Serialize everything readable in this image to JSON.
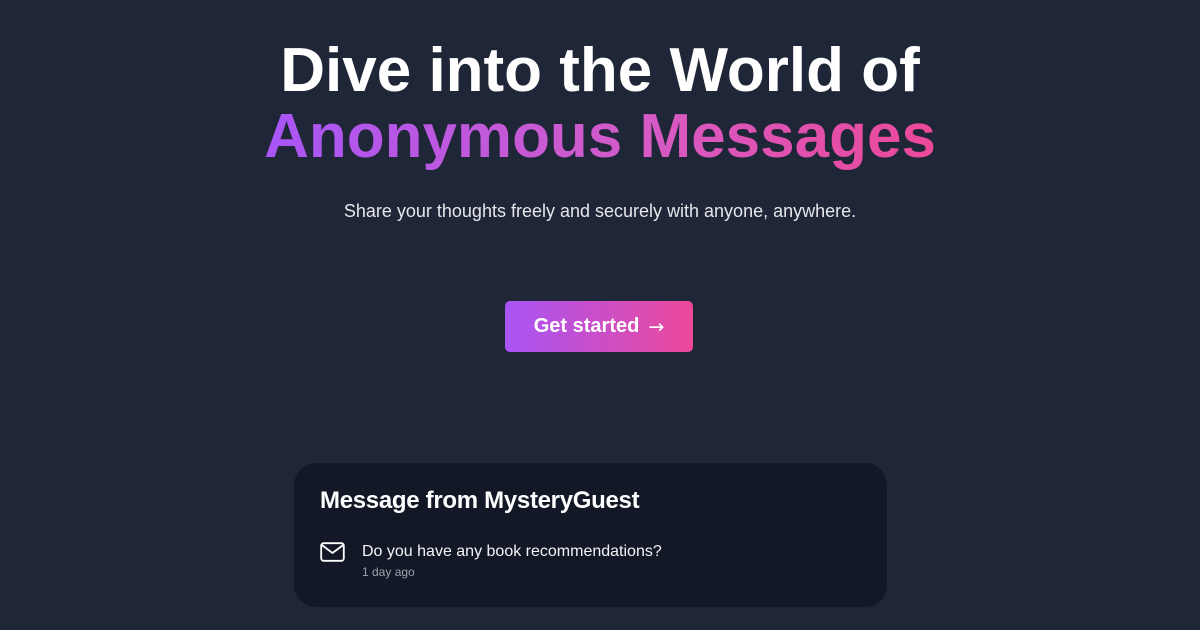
{
  "hero": {
    "headline_line1": "Dive into the World of",
    "headline_line2": "Anonymous Messages",
    "subtitle": "Share your thoughts freely and securely with anyone, anywhere."
  },
  "cta": {
    "label": "Get started",
    "arrow": "→"
  },
  "message_card": {
    "title": "Message from MysteryGuest",
    "icon": "mail-icon",
    "message": "Do you have any book recommendations?",
    "timestamp": "1 day ago"
  },
  "colors": {
    "background": "#1f2637",
    "card_background": "#121826",
    "gradient_start": "#a855f7",
    "gradient_end": "#ec4899",
    "muted_text": "#9ca3af"
  }
}
